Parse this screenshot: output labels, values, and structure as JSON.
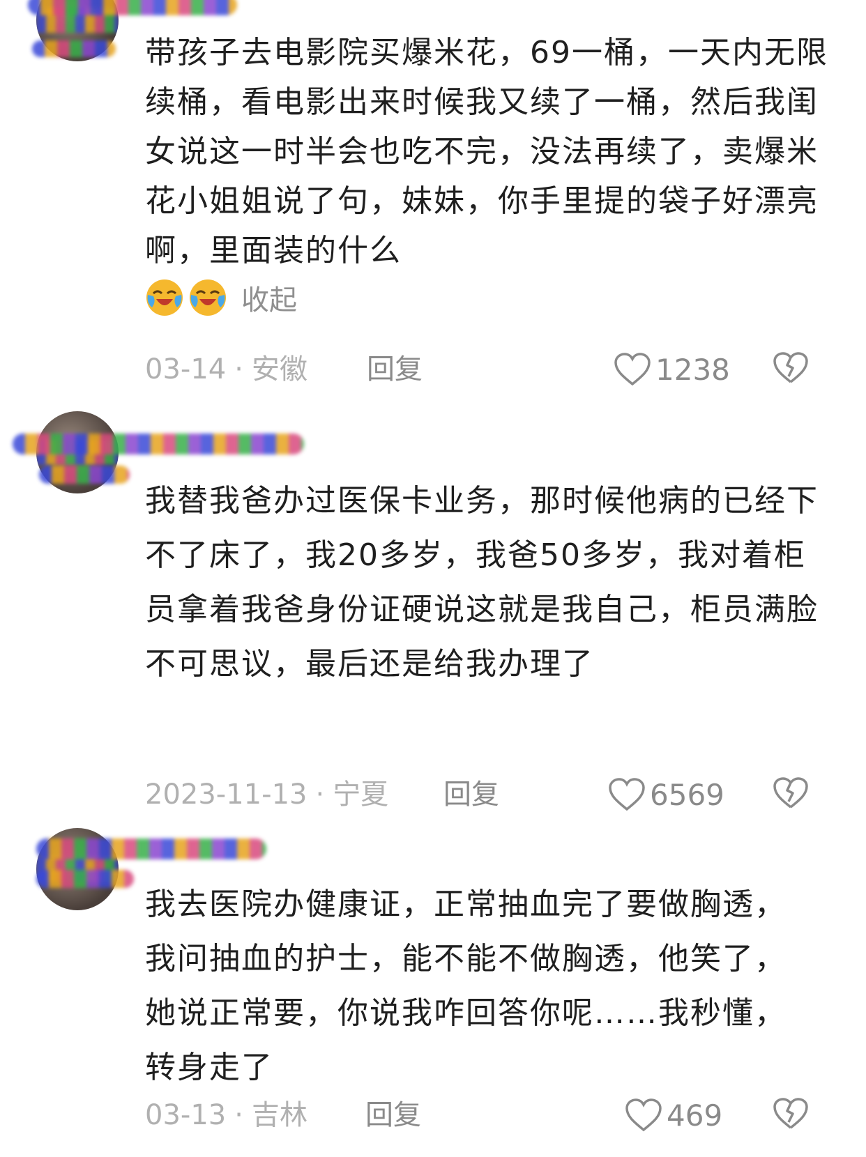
{
  "comments": [
    {
      "username": "",
      "text": "带孩子去电影院买爆米花，69一桶，一天内无限续桶，看电影出来时候我又续了一桶，然后我闺女说这一时半会也吃不完，没法再续了，卖爆米花小姐姐说了句，妹妹，你手里提的袋子好漂亮啊，里面装的什么",
      "emoji": [
        "laughing-crying-emoji",
        "laughing-crying-emoji"
      ],
      "collapse_label": "收起",
      "date": "03-14",
      "location": "安徽",
      "reply_label": "回复",
      "likes": "1238"
    },
    {
      "username": "",
      "text": "我替我爸办过医保卡业务，那时候他病的已经下不了床了，我20多岁，我爸50多岁，我对着柜员拿着我爸身份证硬说这就是我自己，柜员满脸不可思议，最后还是给我办理了",
      "date": "2023-11-13",
      "location": "宁夏",
      "reply_label": "回复",
      "likes": "6569"
    },
    {
      "username": "",
      "text": "我去医院办健康证，正常抽血完了要做胸透，我问抽血的护士，能不能不做胸透，他笑了，她说正常要，你说我咋回答你呢……我秒懂，转身走了",
      "date": "03-13",
      "location": "吉林",
      "reply_label": "回复",
      "likes": "469"
    }
  ],
  "separator": "·",
  "colors": {
    "text": "#1f1f1f",
    "meta": "#b0b0b0",
    "action": "#8a8a8a",
    "emoji_face": "#f5b82e",
    "emoji_tear": "#4aa8e8"
  },
  "icons": [
    "heart-icon",
    "dislike-heart-icon",
    "laughing-crying-emoji"
  ]
}
